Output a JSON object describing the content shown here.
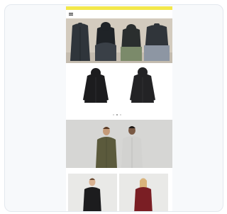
{
  "colors": {
    "promo_banner": "#f3e84a",
    "hero_bg": "#d3cbbe",
    "banner_bg": "#d6d6d4",
    "grid_bg": "#e9e9e7",
    "jacket_black": "#1c1c1e",
    "jacket_olive": "#5b5a3c",
    "jacket_grey": "#d2d2d0",
    "jacket_burgundy": "#7a1e24"
  },
  "promo": {
    "text": ""
  },
  "nav": {
    "logo": "",
    "icons": [
      "menu-icon",
      "search-icon",
      "account-icon",
      "bag-icon"
    ]
  },
  "carousel": {
    "products": [
      {
        "name": ""
      },
      {
        "name": ""
      }
    ],
    "page_count": 3,
    "active_page": 1
  }
}
